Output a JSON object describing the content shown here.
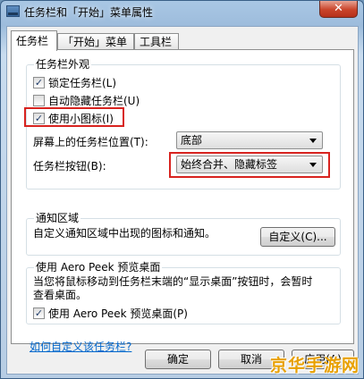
{
  "window": {
    "title": "任务栏和「开始」菜单属性",
    "close_label": "✕"
  },
  "tabs": [
    {
      "label": "任务栏"
    },
    {
      "label": "「开始」菜单"
    },
    {
      "label": "工具栏"
    }
  ],
  "appearance": {
    "legend": "任务栏外观",
    "lock_label": "锁定任务栏(L)",
    "lock_checked": true,
    "autohide_label": "自动隐藏任务栏(U)",
    "autohide_checked": false,
    "small_icons_label": "使用小图标(I)",
    "small_icons_checked": true,
    "location_label": "屏幕上的任务栏位置(T):",
    "location_value": "底部",
    "buttons_label": "任务栏按钮(B):",
    "buttons_value": "始终合并、隐藏标签",
    "check_glyph": "✓"
  },
  "notification": {
    "legend": "通知区域",
    "text": "自定义通知区域中出现的图标和通知。",
    "customize_label": "自定义(C)..."
  },
  "aero": {
    "legend": "使用 Aero Peek 预览桌面",
    "desc_line1": "当您将鼠标移动到任务栏末端的“显示桌面”按钮时，会暂时",
    "desc_line2": "查看桌面。",
    "checkbox_label": "使用 Aero Peek 预览桌面(P)",
    "checked": true
  },
  "help_link": "如何自定义该任务栏?",
  "footer": {
    "ok": "确定",
    "cancel": "取消",
    "apply": "应用(A)"
  },
  "watermark": "京华手游网",
  "colors": {
    "highlight_box": "#d8231f",
    "link": "#0066cc"
  }
}
